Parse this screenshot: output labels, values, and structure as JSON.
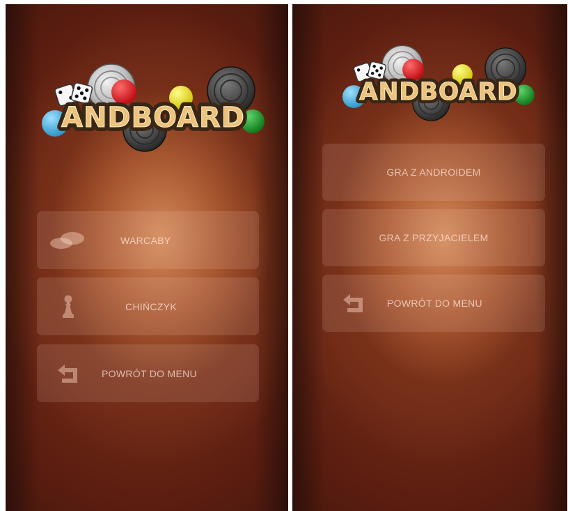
{
  "screens": [
    {
      "logo": {
        "text": "ANDBOARD"
      },
      "menu": [
        {
          "label": "WARCABY",
          "icon": "checkers-piece-icon"
        },
        {
          "label": "CHIŃCZYK",
          "icon": "pawn-icon"
        },
        {
          "label": "POWRÓT DO MENU",
          "icon": "back-arrow-icon"
        }
      ]
    },
    {
      "logo": {
        "text": "ANDBOARD"
      },
      "menu": [
        {
          "label": "GRA Z ANDROIDEM"
        },
        {
          "label": "GRA Z PRZYJACIELEM"
        },
        {
          "label": "POWRÓT DO MENU",
          "icon": "back-arrow-icon"
        }
      ]
    }
  ],
  "colors": {
    "background_center": "#d68c5c",
    "background_edge": "#2a0f0a",
    "button_fill": "rgba(255,225,205,0.13)",
    "button_text": "#ffe8de",
    "logo_text": "#e8c07a",
    "logo_outline": "#3a2614",
    "token_red": "#e0141c",
    "token_yellow": "#e9e221",
    "token_green": "#1e9a2a",
    "token_blue": "#4ab6e6"
  }
}
